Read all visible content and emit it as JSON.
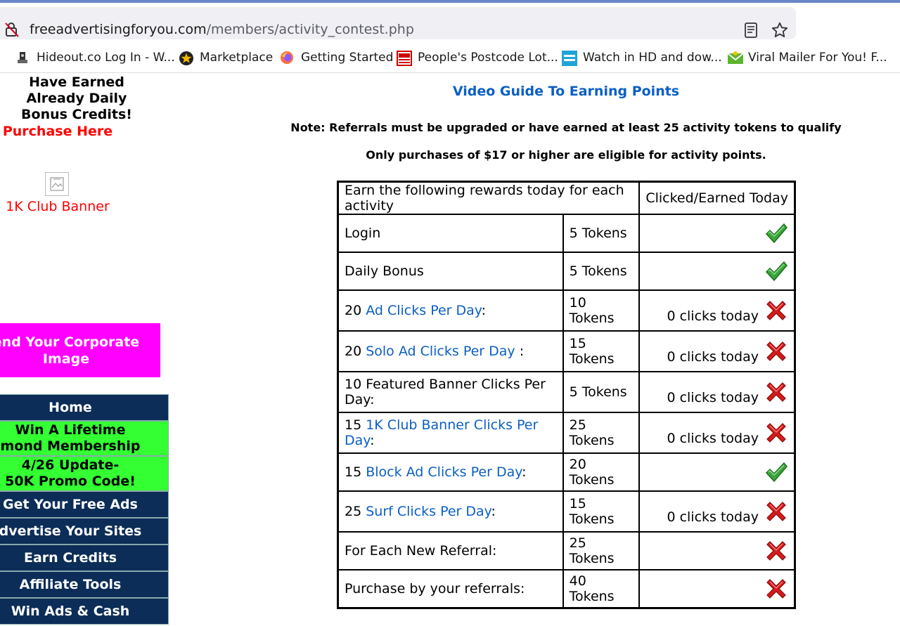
{
  "browser": {
    "url_domain": "freeadvertisingforyou.com",
    "url_path": "/members/activity_contest.php",
    "bookmarks": [
      {
        "label": "Hideout.co Log In - W...",
        "icon": "hideout-icon"
      },
      {
        "label": "Marketplace",
        "icon": "star-badge-icon"
      },
      {
        "label": "Getting Started",
        "icon": "firefox-icon"
      },
      {
        "label": "People's Postcode Lot...",
        "icon": "postcode-lottery-icon"
      },
      {
        "label": "Watch in HD and dow...",
        "icon": "eros-now-icon"
      },
      {
        "label": "Viral Mailer For You! F...",
        "icon": "viral-mailer-icon"
      }
    ]
  },
  "sidebar": {
    "title": "Have Earned Already Daily Bonus Credits!",
    "purchase": "Purchase Here",
    "club_banner": "1K Club Banner",
    "corporate_line1": "end Your Corporate",
    "corporate_line2": "Image",
    "menu": [
      {
        "lines": [
          "Home"
        ],
        "style": "navy"
      },
      {
        "lines": [
          "Win A Lifetime",
          "mond Membership"
        ],
        "style": "green"
      },
      {
        "lines": [
          "4/26 Update-",
          "50K Promo Code!"
        ],
        "style": "green"
      },
      {
        "lines": [
          "Get Your Free Ads"
        ],
        "style": "navy"
      },
      {
        "lines": [
          "dvertise Your Sites"
        ],
        "style": "navy"
      },
      {
        "lines": [
          "Earn Credits"
        ],
        "style": "navy"
      },
      {
        "lines": [
          "Affiliate Tools"
        ],
        "style": "navy"
      },
      {
        "lines": [
          "Win Ads & Cash"
        ],
        "style": "navy"
      }
    ]
  },
  "main": {
    "video_guide": "Video Guide To Earning Points",
    "note": "Note: Referrals must be upgraded or have earned at least 25 activity tokens to qualify",
    "only_purchases": "Only purchases of $17 or higher are eligible for activity points.",
    "table": {
      "header_activity": "Earn the following rewards today for each activity",
      "header_status": "Clicked/Earned Today",
      "rows": [
        {
          "pre": "Login",
          "link": "",
          "post": "",
          "reward": "5 Tokens",
          "clicks": "",
          "done": true
        },
        {
          "pre": "Daily Bonus",
          "link": "",
          "post": "",
          "reward": "5 Tokens",
          "clicks": "",
          "done": true
        },
        {
          "pre": "20 ",
          "link": "Ad Clicks Per Day",
          "post": ":",
          "reward": "10 Tokens",
          "clicks": "0 clicks today",
          "done": false
        },
        {
          "pre": "20 ",
          "link": "Solo Ad Clicks Per Day",
          "post": " :",
          "reward": "15 Tokens",
          "clicks": "0 clicks today",
          "done": false
        },
        {
          "pre": "10 Featured Banner Clicks Per Day:",
          "link": "",
          "post": "",
          "reward": "5 Tokens",
          "clicks": "0 clicks today",
          "done": false
        },
        {
          "pre": "15 ",
          "link": "1K Club Banner Clicks Per Day",
          "post": ":",
          "reward": "25 Tokens",
          "clicks": "0 clicks today",
          "done": false
        },
        {
          "pre": "15 ",
          "link": "Block Ad Clicks Per Day",
          "post": ":",
          "reward": "20 Tokens",
          "clicks": "",
          "done": true
        },
        {
          "pre": "25 ",
          "link": "Surf Clicks Per Day",
          "post": ":",
          "reward": "15 Tokens",
          "clicks": "0 clicks today",
          "done": false
        },
        {
          "pre": "For Each New Referral:",
          "link": "",
          "post": "",
          "reward": "25 Tokens",
          "clicks": "",
          "done": false
        },
        {
          "pre": "Purchase by your referrals:",
          "link": "",
          "post": "",
          "reward": "40 Tokens",
          "clicks": "",
          "done": false
        }
      ]
    }
  }
}
